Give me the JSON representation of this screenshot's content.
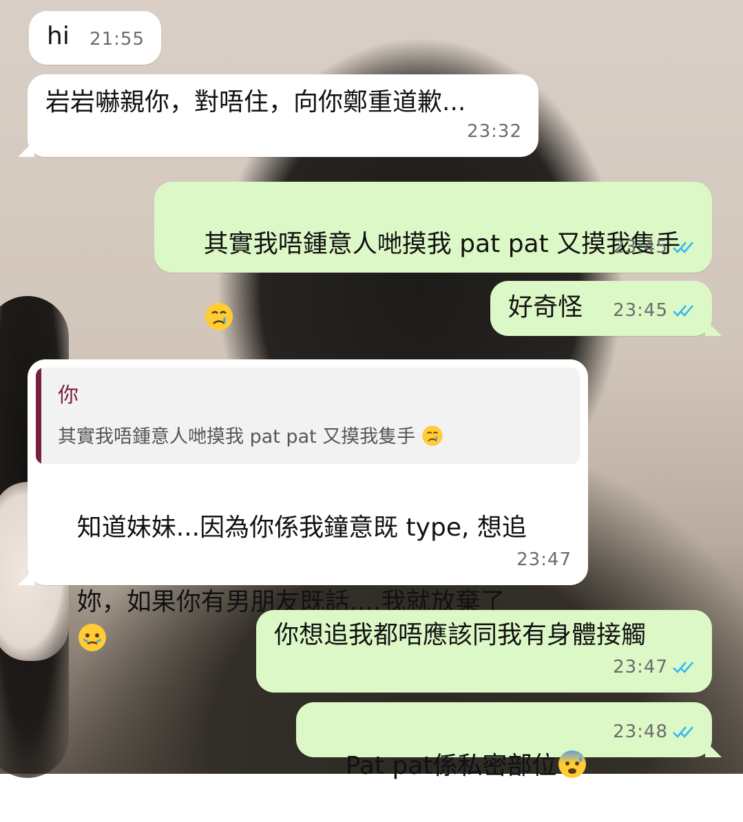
{
  "chat": {
    "messages": [
      {
        "direction": "incoming",
        "text": "hi",
        "time": "21:55"
      },
      {
        "direction": "incoming",
        "text": "岩岩嚇親你，對唔住，向你鄭重道歉...",
        "time": "23:32"
      },
      {
        "direction": "outgoing",
        "text": "其實我唔鍾意人哋摸我 pat pat 又摸我隻手",
        "emoji": "crying-face-emoji",
        "time": "23:45",
        "status": "read"
      },
      {
        "direction": "outgoing",
        "text": "好奇怪",
        "time": "23:45",
        "status": "read"
      },
      {
        "direction": "incoming",
        "quote": {
          "author": "你",
          "text": "其實我唔鍾意人哋摸我 pat pat 又摸我隻手",
          "emoji": "crying-face-emoji"
        },
        "text_line1": "知道妹妹...因為你係我鐘意既 type, 想追",
        "text_line2": "妳，如果你有男朋友既話....我就放棄了",
        "emoji": "face-holding-back-tears-emoji",
        "time": "23:47"
      },
      {
        "direction": "outgoing",
        "text": "你想追我都唔應該同我有身體接觸",
        "time": "23:47",
        "status": "read"
      },
      {
        "direction": "outgoing",
        "text": "Pat pat係私密部位",
        "emoji": "anxious-face-with-sweat-emoji",
        "time": "23:48",
        "status": "read"
      }
    ]
  },
  "colors": {
    "incoming_bubble": "#ffffff",
    "outgoing_bubble": "#dcf8c6",
    "read_ticks": "#34b7f1",
    "quote_accent": "#7a1f3d"
  }
}
